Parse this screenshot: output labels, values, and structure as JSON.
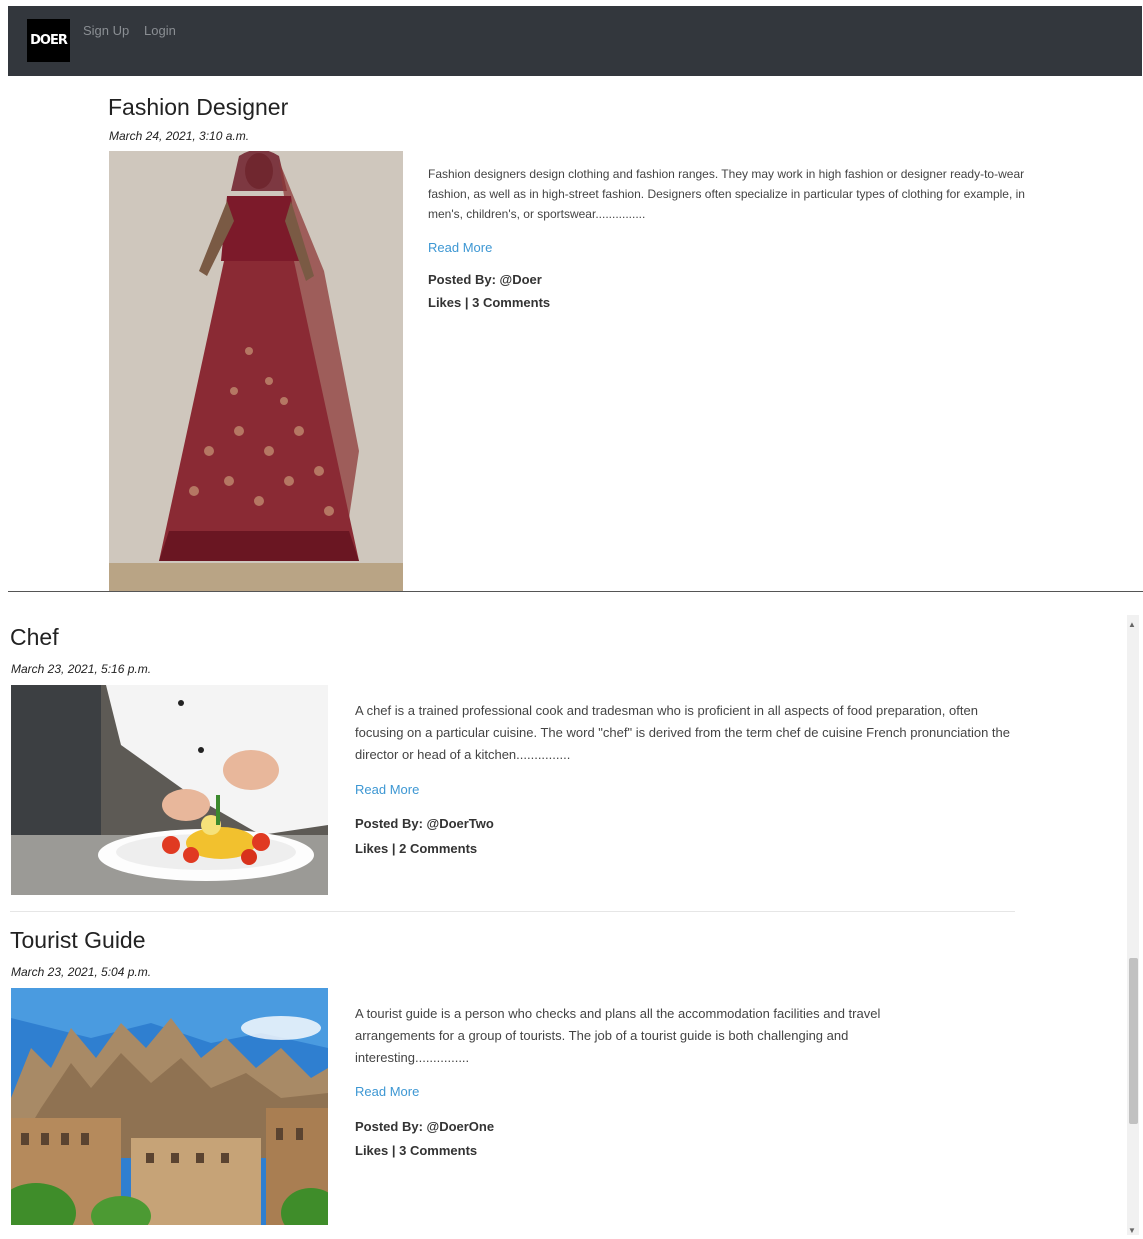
{
  "navbar": {
    "brand": "DOER",
    "links": [
      "Sign Up",
      "Login"
    ]
  },
  "posts": [
    {
      "title": "Fashion Designer",
      "date": "March 24, 2021, 3:10 a.m.",
      "excerpt": "Fashion designers design clothing and fashion ranges. They may work in high fashion or designer ready-to-wear fashion, as well as in high-street fashion. Designers often specialize in particular types of clothing for example, in men's, children's, or sportswear...............",
      "read_more": "Read More",
      "posted_by": "Posted By: @Doer",
      "likes": "Likes | 3 Comments"
    },
    {
      "title": "Chef",
      "date": "March 23, 2021, 5:16 p.m.",
      "excerpt": "A chef is a trained professional cook and tradesman who is proficient in all aspects of food preparation, often focusing on a particular cuisine. The word \"chef\" is derived from the term chef de cuisine French pronunciation the director or head of a kitchen...............",
      "read_more": "Read More",
      "posted_by": "Posted By: @DoerTwo",
      "likes": "Likes | 2 Comments"
    },
    {
      "title": "Tourist Guide",
      "date": "March 23, 2021, 5:04 p.m.",
      "excerpt": "A tourist guide is a person who checks and plans all the accommodation facilities and travel arrangements for a group of tourists. The job of a tourist guide is both challenging and interesting...............",
      "read_more": "Read More",
      "posted_by": "Posted By: @DoerOne",
      "likes": "Likes | 3 Comments"
    }
  ]
}
